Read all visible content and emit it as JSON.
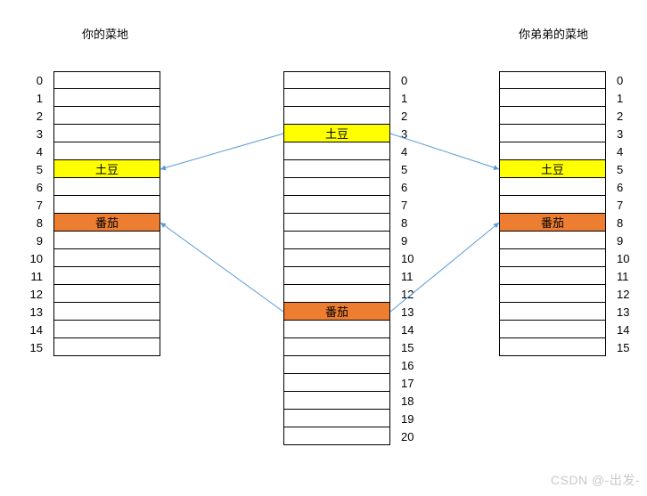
{
  "titles": {
    "left": "你的菜地",
    "right": "你弟弟的菜地"
  },
  "columns": {
    "left": {
      "rows": 16,
      "items": {
        "5": {
          "label": "土豆",
          "color": "yellow"
        },
        "8": {
          "label": "番茄",
          "color": "orange"
        }
      }
    },
    "center": {
      "rows": 21,
      "items": {
        "3": {
          "label": "土豆",
          "color": "yellow"
        },
        "13": {
          "label": "番茄",
          "color": "orange"
        }
      }
    },
    "right": {
      "rows": 16,
      "items": {
        "5": {
          "label": "土豆",
          "color": "yellow"
        },
        "8": {
          "label": "番茄",
          "color": "orange"
        }
      }
    }
  },
  "indices": {
    "leftA": {
      "count": 16,
      "align": "left"
    },
    "centerR": {
      "count": 21,
      "align": "right"
    },
    "rightR": {
      "count": 16,
      "align": "right"
    }
  },
  "arrows": [
    {
      "from": "center.3.left",
      "to": "left.5.right"
    },
    {
      "from": "center.3.right",
      "to": "right.5.left"
    },
    {
      "from": "center.13.left",
      "to": "left.8.right"
    },
    {
      "from": "center.13.right",
      "to": "right.8.left"
    }
  ],
  "watermark": "CSDN @-出发-",
  "chart_data": {
    "type": "table",
    "description": "Hash-like mapping from a center array (21 slots) to two arrays (16 slots each)",
    "left_array": {
      "size": 16,
      "entries": [
        {
          "index": 5,
          "value": "土豆"
        },
        {
          "index": 8,
          "value": "番茄"
        }
      ]
    },
    "center_array": {
      "size": 21,
      "entries": [
        {
          "index": 3,
          "value": "土豆"
        },
        {
          "index": 13,
          "value": "番茄"
        }
      ]
    },
    "right_array": {
      "size": 16,
      "entries": [
        {
          "index": 5,
          "value": "土豆"
        },
        {
          "index": 8,
          "value": "番茄"
        }
      ]
    },
    "mappings": [
      {
        "from_array": "center",
        "from_index": 3,
        "to_array": "left",
        "to_index": 5
      },
      {
        "from_array": "center",
        "from_index": 3,
        "to_array": "right",
        "to_index": 5
      },
      {
        "from_array": "center",
        "from_index": 13,
        "to_array": "left",
        "to_index": 8
      },
      {
        "from_array": "center",
        "from_index": 13,
        "to_array": "right",
        "to_index": 8
      }
    ]
  }
}
